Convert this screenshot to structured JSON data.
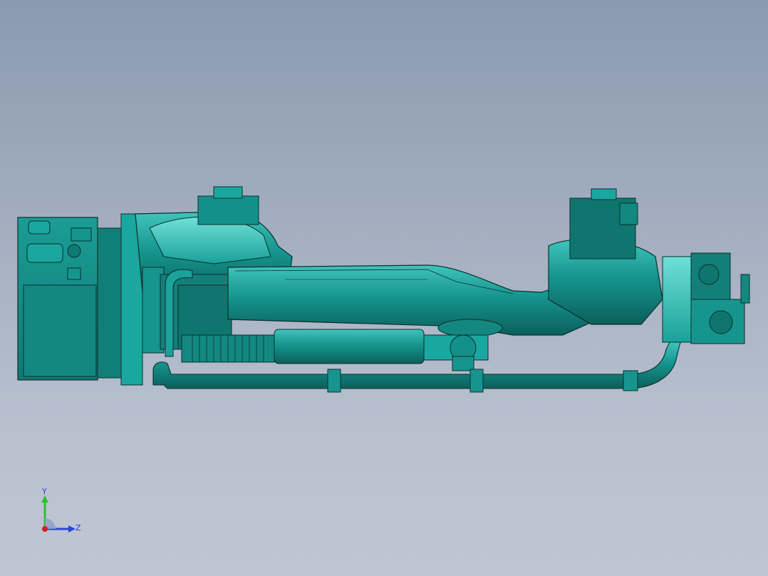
{
  "viewport": {
    "background_top": "#8b9ab0",
    "background_bottom": "#bfc6d3"
  },
  "model": {
    "part_color": "#118a84",
    "part_highlight": "#3fc4bc",
    "part_shadow": "#0b5f5b",
    "edge_color": "#0a2e2c"
  },
  "triad": {
    "y_label": "Y",
    "z_label": "Z",
    "y_color": "#2fbf2f",
    "z_color": "#2f46d8",
    "x_color": "#d02020"
  }
}
